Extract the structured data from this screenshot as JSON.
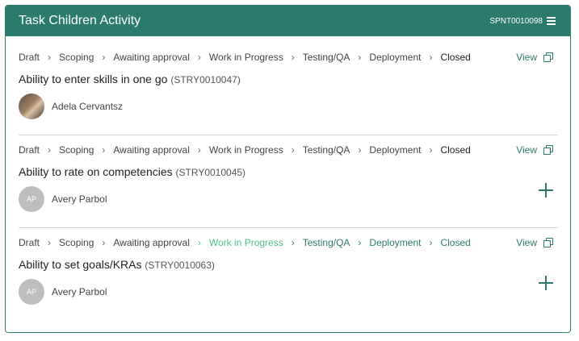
{
  "header": {
    "title": "Task Children Activity",
    "ref": "SPNT0010098"
  },
  "items": [
    {
      "stages": [
        "Draft",
        "Scoping",
        "Awaiting approval",
        "Work in Progress",
        "Testing/QA",
        "Deployment",
        "Closed"
      ],
      "view_label": "View",
      "name": "Ability to enter skills in one go",
      "code": "(STRY0010047)",
      "user": {
        "initials": "",
        "name": "Adela Cervantsz"
      }
    },
    {
      "stages": [
        "Draft",
        "Scoping",
        "Awaiting approval",
        "Work in Progress",
        "Testing/QA",
        "Deployment",
        "Closed"
      ],
      "view_label": "View",
      "name": "Ability to rate on competencies",
      "code": "(STRY0010045)",
      "user": {
        "initials": "AP",
        "name": "Avery Parbol"
      }
    },
    {
      "stages": [
        "Draft",
        "Scoping",
        "Awaiting approval",
        "Work in Progress",
        "Testing/QA",
        "Deployment",
        "Closed"
      ],
      "view_label": "View",
      "name": "Ability to set goals/KRAs",
      "code": "(STRY0010063)",
      "user": {
        "initials": "AP",
        "name": "Avery Parbol"
      }
    }
  ],
  "colors": {
    "accent": "#2b7a6e",
    "current_stage": "#4cbf8a",
    "avatar_gray": "#bdbdbd"
  }
}
